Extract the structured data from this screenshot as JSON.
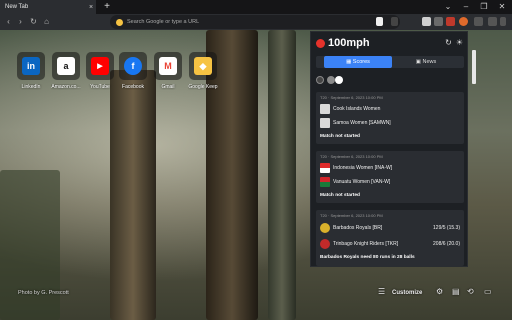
{
  "browser": {
    "tab_title": "New Tab",
    "tab_close": "×",
    "new_tab": "+",
    "omnibox_placeholder": "Search Google or type a URL"
  },
  "shortcuts": [
    {
      "label": "LinkedIn",
      "glyph": "in",
      "color": "#0a66c2"
    },
    {
      "label": "Amazon.co...",
      "glyph": "a",
      "color": "#111111"
    },
    {
      "label": "YouTube",
      "glyph": "▶",
      "color": "#ff0000"
    },
    {
      "label": "Facebook",
      "glyph": "f",
      "color": "#1877f2"
    },
    {
      "label": "Gmail",
      "glyph": "M",
      "color": "#202124"
    },
    {
      "label": "Google Keep",
      "glyph": "◆",
      "color": "#f6c343"
    }
  ],
  "footer": {
    "photo_credit": "Photo by G. Prescott",
    "customize": "Customize"
  },
  "popup": {
    "brand": "100mph",
    "tabs": [
      "Scores",
      "News"
    ],
    "matches": [
      {
        "meta": "T20 · September 6, 2023 10:00 PM",
        "teams": [
          {
            "name": "Cook Islands Women",
            "score": "",
            "flag": "#d9d9d9"
          },
          {
            "name": "Samoa Women [SAMWN]",
            "score": "",
            "flag": "#d9d9d9"
          }
        ],
        "status": "Match not started"
      },
      {
        "meta": "T20 · September 6, 2023 10:00 PM",
        "teams": [
          {
            "name": "Indonesia Women [INA-W]",
            "score": "",
            "flag": "#e02b2b"
          },
          {
            "name": "Vanuatu Women [VAN-W]",
            "score": "",
            "flag": "#1b7a3a"
          }
        ],
        "status": "Match not started"
      },
      {
        "meta": "T20 · September 6, 2023 10:00 PM",
        "teams": [
          {
            "name": "Barbados Royals [BR]",
            "score": "129/5 (15.3)",
            "flag": "#d9b12b"
          },
          {
            "name": "Trinbago Knight Riders [TKR]",
            "score": "208/6 (20.0)",
            "flag": "#c12a2a"
          }
        ],
        "status": "Barbados Royals need 80 runs in 28 balls"
      }
    ]
  }
}
